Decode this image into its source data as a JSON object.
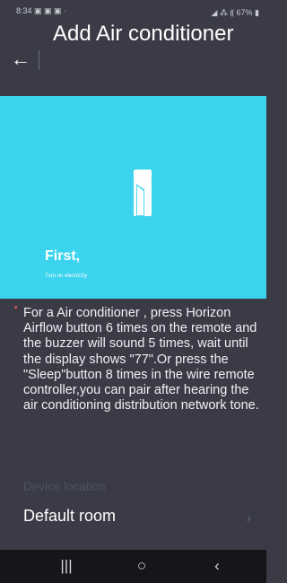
{
  "status_bar": {
    "time": "8:34",
    "left_icons": "▣ ▣ ▣ ·",
    "right_icons": "◢ ⁂ ⸨ 67% ▮"
  },
  "header": {
    "back_icon": "arrow-left-icon",
    "title": "Add Air conditioner"
  },
  "hero": {
    "background": "#3bd3ee",
    "title": "First,",
    "subtitle": "Turn on electricity"
  },
  "instructions": {
    "required_marker": "•",
    "text": "For a Air conditioner , press Horizon Airflow button 6 times on the remote and the buzzer will sound 5 times, wait until the display shows \"77\".Or press the \"Sleep\"button 8 times in the wire remote controller,you can pair after hearing the air conditioning distribution network tone."
  },
  "device_location": {
    "label": "Device location",
    "value": "Default room",
    "chevron": "›"
  },
  "nav_bar": {
    "recents_icon": "|||",
    "home_icon": "○",
    "back_icon": "‹"
  }
}
